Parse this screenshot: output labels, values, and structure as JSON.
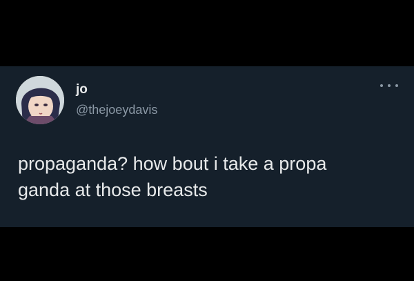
{
  "tweet": {
    "author": {
      "display_name": "jo",
      "handle": "@thejoeydavis",
      "avatar_icon": "anime-avatar"
    },
    "more_icon": "more-horizontal-icon",
    "text_lines": [
      "propaganda? how bout i take a propa",
      "ganda at those breasts"
    ]
  },
  "colors": {
    "background": "#000000",
    "card": "#15202b",
    "primary_text": "#e7e9ea",
    "secondary_text": "#8b98a5"
  }
}
